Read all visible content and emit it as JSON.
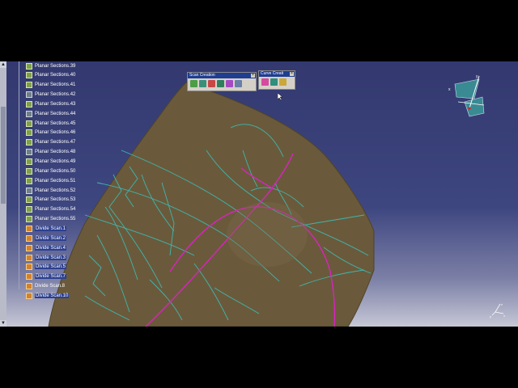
{
  "tree": {
    "items": [
      {
        "label": "Planar Sections.39",
        "icon": "planar-section-icon"
      },
      {
        "label": "Planar Sections.40",
        "icon": "planar-section-icon"
      },
      {
        "label": "Planar Sections.41",
        "icon": "planar-section-icon"
      },
      {
        "label": "Planar Sections.42",
        "icon": "planar-section-icon"
      },
      {
        "label": "Planar Sections.43",
        "icon": "planar-section-icon"
      },
      {
        "label": "Planar Sections.44",
        "icon": "planar-section-icon"
      },
      {
        "label": "Planar Sections.45",
        "icon": "planar-section-icon"
      },
      {
        "label": "Planar Sections.46",
        "icon": "planar-section-icon"
      },
      {
        "label": "Planar Sections.47",
        "icon": "planar-section-icon"
      },
      {
        "label": "Planar Sections.48",
        "icon": "planar-section-icon"
      },
      {
        "label": "Planar Sections.49",
        "icon": "planar-section-icon"
      },
      {
        "label": "Planar Sections.50",
        "icon": "planar-section-icon"
      },
      {
        "label": "Planar Sections.51",
        "icon": "planar-section-icon"
      },
      {
        "label": "Planar Sections.52",
        "icon": "planar-section-icon"
      },
      {
        "label": "Planar Sections.53",
        "icon": "planar-section-icon"
      },
      {
        "label": "Planar Sections.54",
        "icon": "planar-section-icon"
      },
      {
        "label": "Planar Sections.55",
        "icon": "planar-section-icon"
      },
      {
        "label": "Divide Scan.1",
        "icon": "divide-scan-icon"
      },
      {
        "label": "Divide Scan.2",
        "icon": "divide-scan-icon"
      },
      {
        "label": "Divide Scan.4",
        "icon": "divide-scan-icon"
      },
      {
        "label": "Divide Scan.3",
        "icon": "divide-scan-icon"
      },
      {
        "label": "Divide Scan.5",
        "icon": "divide-scan-icon"
      },
      {
        "label": "Divide Scan.7",
        "icon": "divide-scan-icon"
      },
      {
        "label": "Divide Scan.8",
        "icon": "divide-scan-icon"
      },
      {
        "label": "Divide Scan.10",
        "icon": "divide-scan-icon"
      }
    ]
  },
  "toolbars": {
    "scan_creation": {
      "title": "Scan Creation",
      "buttons": [
        "sketch-on-scan-icon",
        "planar-sections-icon",
        "scan-on-cloud-icon",
        "free-edge-icon",
        "curve-projection-icon",
        "split-scan-icon"
      ]
    },
    "curve_creation": {
      "title": "Curve Creati",
      "buttons": [
        "3d-curve-icon",
        "curve-on-cloud-icon",
        "blend-curve-icon"
      ]
    }
  },
  "compass": {
    "x_label": "x",
    "y_label": "y"
  },
  "axis": {
    "x_label": "x",
    "y_label": "y",
    "z_label": "z"
  },
  "colors": {
    "surface": "#6a5a3b",
    "section_curve": "#3fb6b0",
    "magenta_curve": "#e020c8",
    "background_top": "#33396f",
    "background_bottom": "#c6c7d6"
  }
}
